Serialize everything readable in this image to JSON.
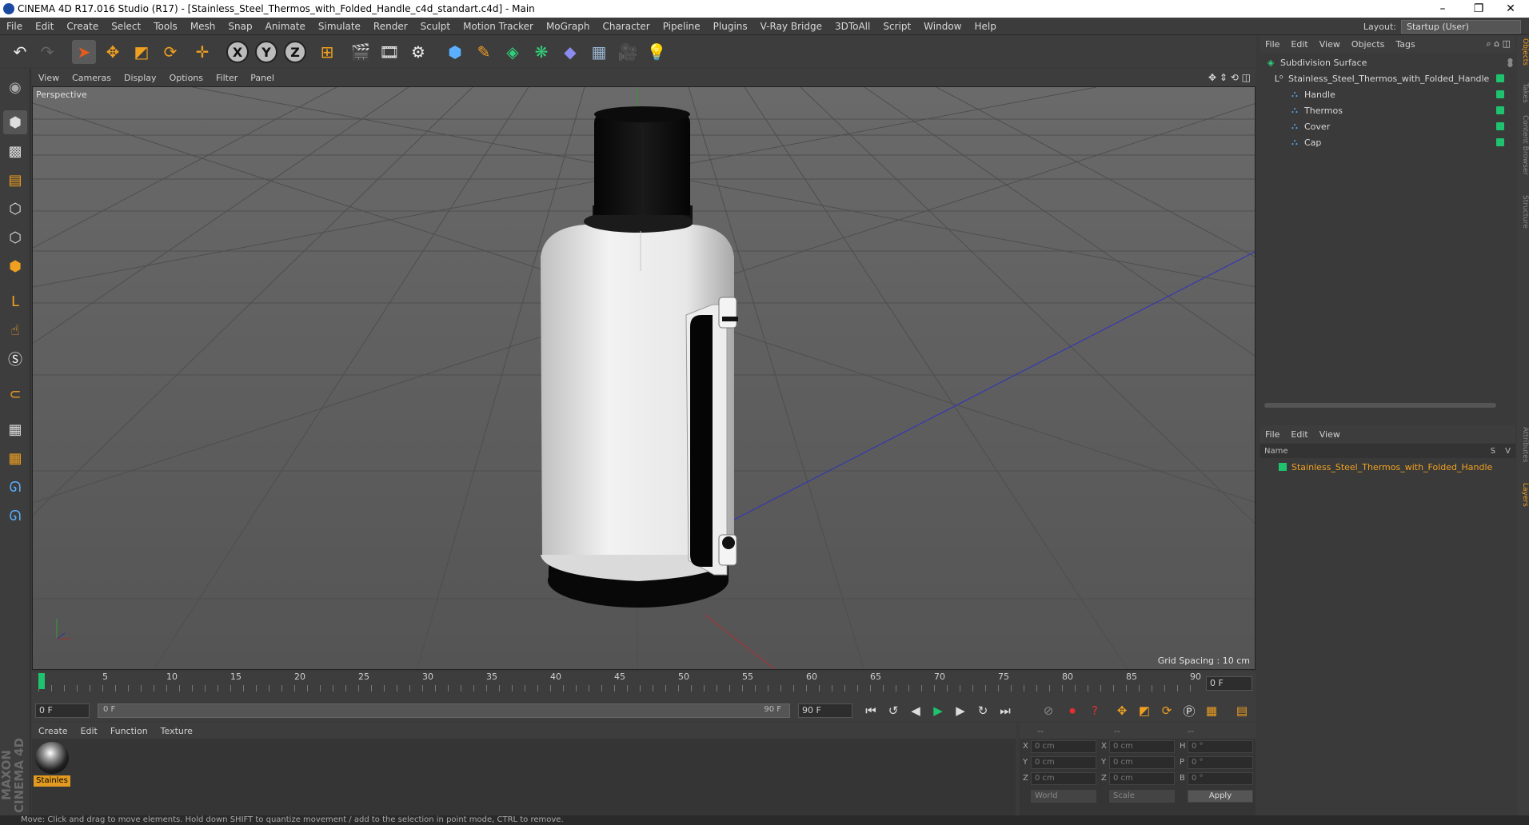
{
  "window": {
    "title": "CINEMA 4D R17.016 Studio (R17) - [Stainless_Steel_Thermos_with_Folded_Handle_c4d_standart.c4d] - Main",
    "minimize": "–",
    "restore": "❐",
    "close": "✕"
  },
  "menubar": {
    "items": [
      "File",
      "Edit",
      "Create",
      "Select",
      "Tools",
      "Mesh",
      "Snap",
      "Animate",
      "Simulate",
      "Render",
      "Sculpt",
      "Motion Tracker",
      "MoGraph",
      "Character",
      "Pipeline",
      "Plugins",
      "V-Ray Bridge",
      "3DToAll",
      "Script",
      "Window",
      "Help"
    ],
    "layout_label": "Layout:",
    "layout_value": "Startup (User)"
  },
  "toolbar": {
    "axis_x": "X",
    "axis_y": "Y",
    "axis_z": "Z"
  },
  "viewport": {
    "menu": [
      "View",
      "Cameras",
      "Display",
      "Options",
      "Filter",
      "Panel"
    ],
    "label": "Perspective",
    "grid_spacing": "Grid Spacing : 10 cm"
  },
  "timeline": {
    "ticks": [
      "0",
      "5",
      "10",
      "15",
      "20",
      "25",
      "30",
      "35",
      "40",
      "45",
      "50",
      "55",
      "60",
      "65",
      "70",
      "75",
      "80",
      "85",
      "90"
    ],
    "current_frame": "0 F",
    "start_frame": "0 F",
    "range_start": "0 F",
    "range_end": "90 F",
    "end_frame": "90 F"
  },
  "material_manager": {
    "menu": [
      "Create",
      "Edit",
      "Function",
      "Texture"
    ],
    "material_name": "Stainles"
  },
  "coordinates": {
    "header": [
      "--",
      "--",
      "--"
    ],
    "rows": [
      {
        "a": "X",
        "av": "0 cm",
        "b": "X",
        "bv": "0 cm",
        "c": "H",
        "cv": "0 °"
      },
      {
        "a": "Y",
        "av": "0 cm",
        "b": "Y",
        "bv": "0 cm",
        "c": "P",
        "cv": "0 °"
      },
      {
        "a": "Z",
        "av": "0 cm",
        "b": "Z",
        "bv": "0 cm",
        "c": "B",
        "cv": "0 °"
      }
    ],
    "mode": "World",
    "scale": "Scale",
    "apply": "Apply"
  },
  "object_manager": {
    "menu": [
      "File",
      "Edit",
      "View",
      "Objects",
      "Tags"
    ],
    "objects": [
      {
        "name": "Subdivision Surface",
        "indent": 0
      },
      {
        "name": "Stainless_Steel_Thermos_with_Folded_Handle",
        "indent": 1
      },
      {
        "name": "Handle",
        "indent": 2
      },
      {
        "name": "Thermos",
        "indent": 2
      },
      {
        "name": "Cover",
        "indent": 2
      },
      {
        "name": "Cap",
        "indent": 2
      }
    ]
  },
  "layer_manager": {
    "menu": [
      "File",
      "Edit",
      "View"
    ],
    "col_name": "Name",
    "col_s": "S",
    "col_v": "V",
    "layer_name": "Stainless_Steel_Thermos_with_Folded_Handle"
  },
  "side_tabs": [
    "Objects",
    "Takes",
    "Content Browser",
    "Structure",
    "Attributes",
    "Layers"
  ],
  "status": "Move: Click and drag to move elements. Hold down SHIFT to quantize movement / add to the selection in point mode, CTRL to remove.",
  "maxon": "MAXON CINEMA 4D"
}
